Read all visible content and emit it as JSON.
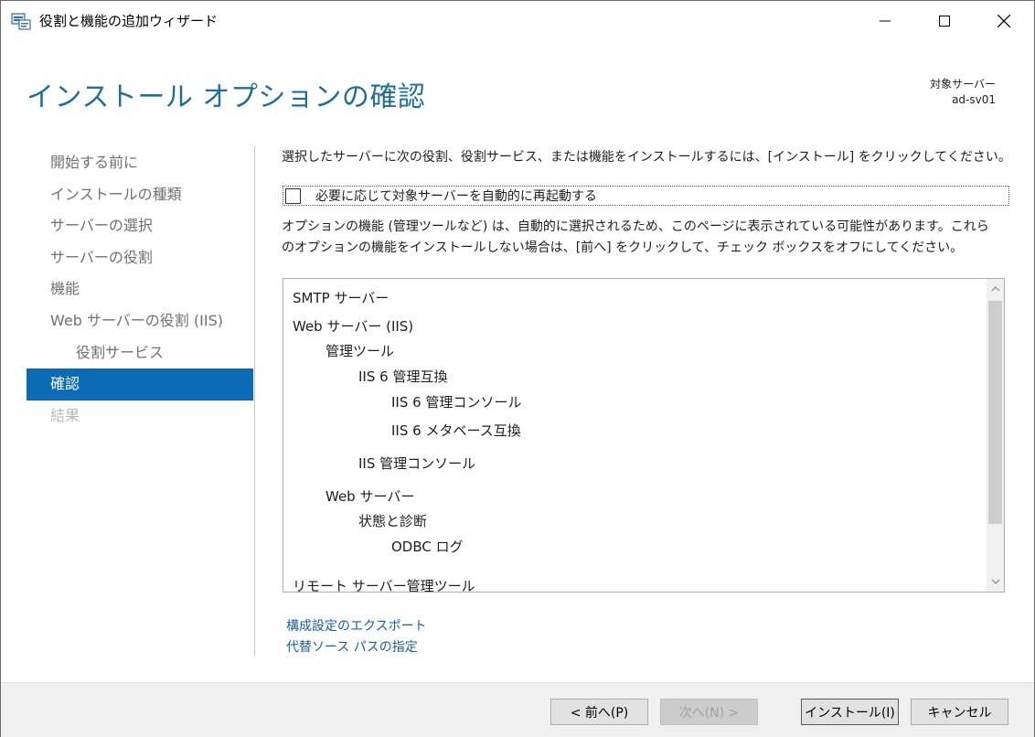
{
  "window": {
    "title": "役割と機能の追加ウィザード"
  },
  "header": {
    "page_title": "インストール オプションの確認",
    "target_label": "対象サーバー",
    "target_value": "ad-sv01"
  },
  "nav": {
    "items": [
      {
        "label": "開始する前に",
        "state": "normal"
      },
      {
        "label": "インストールの種類",
        "state": "normal"
      },
      {
        "label": "サーバーの選択",
        "state": "normal"
      },
      {
        "label": "サーバーの役割",
        "state": "normal"
      },
      {
        "label": "機能",
        "state": "normal"
      },
      {
        "label": "Web サーバーの役割 (IIS)",
        "state": "normal"
      },
      {
        "label": "役割サービス",
        "state": "sub"
      },
      {
        "label": "確認",
        "state": "active"
      },
      {
        "label": "結果",
        "state": "disabled"
      }
    ]
  },
  "main": {
    "intro": "選択したサーバーに次の役割、役割サービス、または機能をインストールするには、[インストール] をクリックしてください。",
    "restart_label": "必要に応じて対象サーバーを自動的に再起動する",
    "restart_checked": false,
    "optional_note_line1": "オプションの機能 (管理ツールなど) は、自動的に選択されるため、このページに表示されている可能性があります。これら",
    "optional_note_line2": "のオプションの機能をインストールしない場合は、[前へ] をクリックして、チェック ボックスをオフにしてください。",
    "features": [
      {
        "label": "SMTP サーバー",
        "level": 0
      },
      {
        "label": "Web サーバー (IIS)",
        "level": 0
      },
      {
        "label": "管理ツール",
        "level": 1
      },
      {
        "label": "IIS 6 管理互換",
        "level": 2
      },
      {
        "label": "IIS 6 管理コンソール",
        "level": 3
      },
      {
        "label": "IIS 6 メタベース互換",
        "level": 3
      },
      {
        "label": "IIS 管理コンソール",
        "level": 2
      },
      {
        "label": "Web サーバー",
        "level": 1
      },
      {
        "label": "状態と診断",
        "level": 2
      },
      {
        "label": "ODBC ログ",
        "level": 3
      },
      {
        "label": "リモート サーバー管理ツール",
        "level": 0
      }
    ],
    "export_link": "構成設定のエクスポート",
    "alt_source_link": "代替ソース パスの指定"
  },
  "footer": {
    "prev_label": "< 前へ(P)",
    "next_label": "次へ(N) >",
    "install_label": "インストール(I)",
    "cancel_label": "キャンセル"
  }
}
